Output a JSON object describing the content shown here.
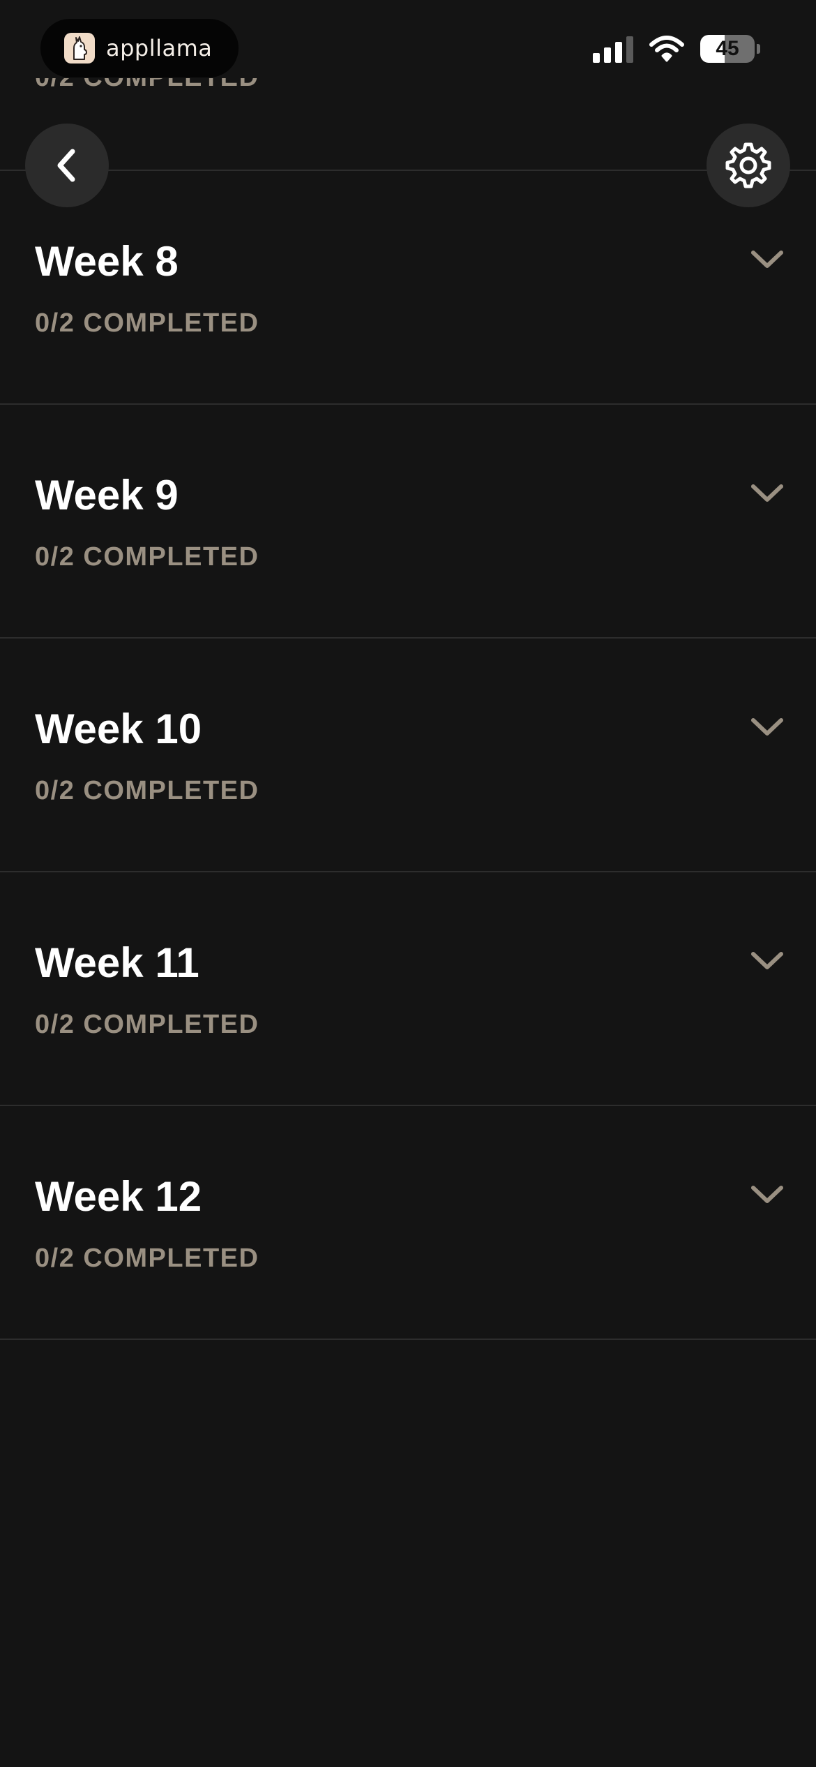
{
  "status_bar": {
    "app_name": "appllama",
    "battery": "45",
    "battery_level": 0.45
  },
  "scroll_peek": {
    "progress": "0/2 COMPLETED"
  },
  "navigation": {
    "back_icon": "chevron-left-icon",
    "settings_icon": "gear-icon"
  },
  "weeks": [
    {
      "title": "Week 8",
      "progress": "0/2 COMPLETED"
    },
    {
      "title": "Week 9",
      "progress": "0/2 COMPLETED"
    },
    {
      "title": "Week 10",
      "progress": "0/2 COMPLETED"
    },
    {
      "title": "Week 11",
      "progress": "0/2 COMPLETED"
    },
    {
      "title": "Week 12",
      "progress": "0/2 COMPLETED"
    }
  ],
  "colors": {
    "background": "#141414",
    "title": "#ffffff",
    "progress_text": "#9a9082",
    "chevron": "#9a9082",
    "divider": "#2d2d2d",
    "button_bg": "#2b2b2b"
  }
}
